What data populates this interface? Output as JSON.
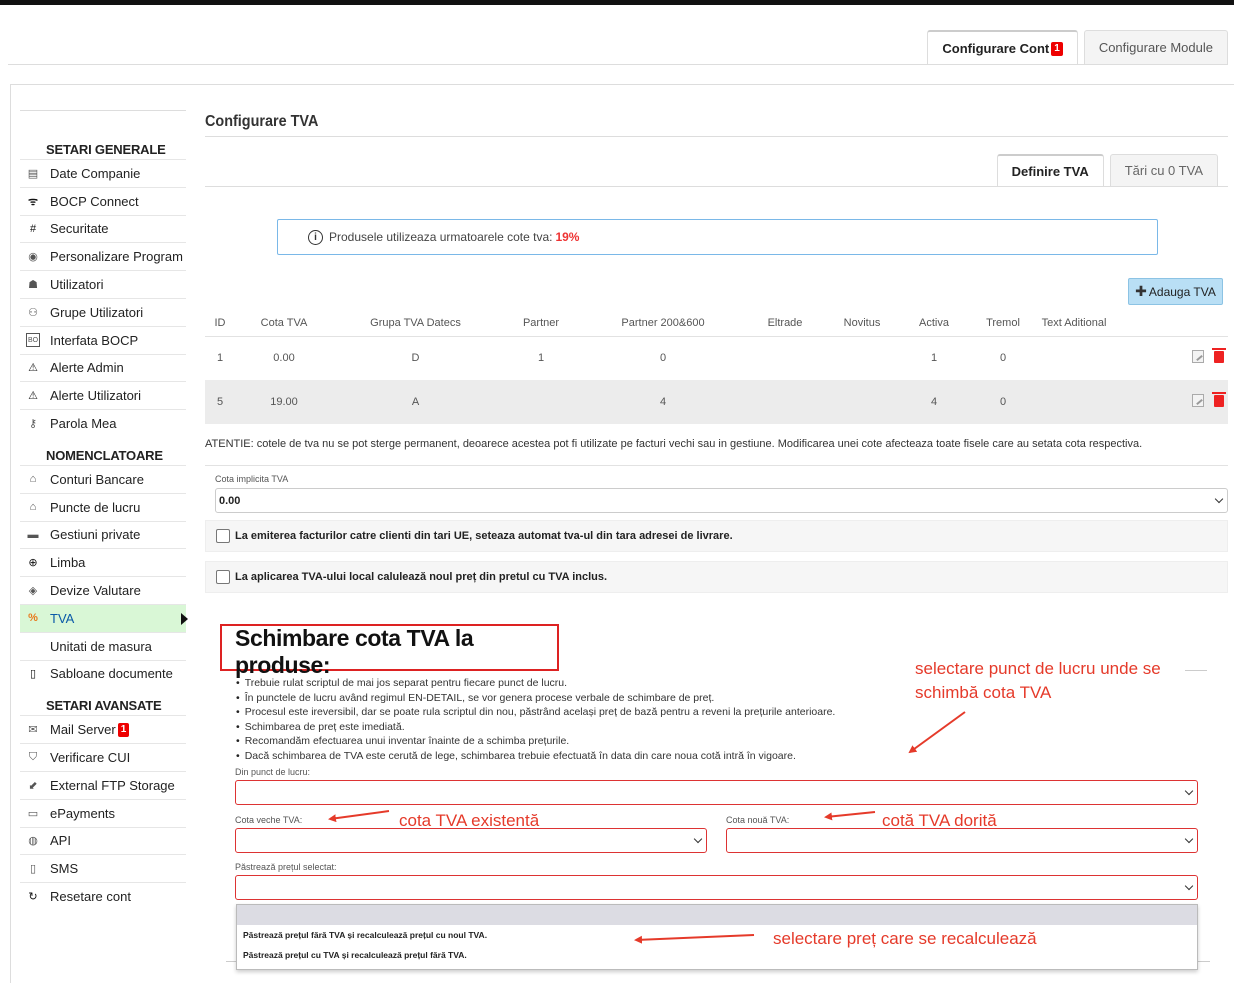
{
  "top_tabs": [
    {
      "label": "Configurare Cont",
      "badge": "1",
      "active": true
    },
    {
      "label": "Configurare Module",
      "active": false
    }
  ],
  "sidebar": {
    "sections": [
      {
        "title": "SETARI GENERALE",
        "items": [
          {
            "label": "Date Companie",
            "icon": "id-card-icon"
          },
          {
            "label": "BOCP Connect",
            "icon": "rss-icon"
          },
          {
            "label": "Securitate",
            "icon": "grid-lock-icon"
          },
          {
            "label": "Personalizare Program",
            "icon": "palette-icon"
          },
          {
            "label": "Utilizatori",
            "icon": "user-icon"
          },
          {
            "label": "Grupe Utilizatori",
            "icon": "users-icon"
          },
          {
            "label": "Interfata BOCP",
            "icon": "bocp-icon"
          },
          {
            "label": "Alerte Admin",
            "icon": "warning-icon"
          },
          {
            "label": "Alerte Utilizatori",
            "icon": "warning-icon"
          },
          {
            "label": "Parola Mea",
            "icon": "key-icon"
          }
        ]
      },
      {
        "title": "NOMENCLATOARE",
        "items": [
          {
            "label": "Conturi Bancare",
            "icon": "bank-icon"
          },
          {
            "label": "Puncte de lucru",
            "icon": "home-icon"
          },
          {
            "label": "Gestiuni private",
            "icon": "hat-icon"
          },
          {
            "label": "Limba",
            "icon": "globe-icon"
          },
          {
            "label": "Devize Valutare",
            "icon": "money-icon"
          },
          {
            "label": "TVA",
            "icon": "percent-icon",
            "active": true
          },
          {
            "label": "Unitati de masura",
            "icon": ""
          },
          {
            "label": "Sabloane documente",
            "icon": "document-icon"
          }
        ]
      },
      {
        "title": "SETARI AVANSATE",
        "items": [
          {
            "label": "Mail Server",
            "icon": "mail-icon",
            "badge": "1"
          },
          {
            "label": "Verificare CUI",
            "icon": "shield-icon"
          },
          {
            "label": "External FTP Storage",
            "icon": "ftp-icon"
          },
          {
            "label": "ePayments",
            "icon": "card-icon"
          },
          {
            "label": "API",
            "icon": "api-icon"
          },
          {
            "label": "SMS",
            "icon": "sms-icon"
          },
          {
            "label": "Resetare cont",
            "icon": "refresh-icon"
          }
        ]
      }
    ]
  },
  "main": {
    "title": "Configurare TVA",
    "sub_tabs": [
      {
        "label": "Definire TVA",
        "active": true
      },
      {
        "label": "Tări cu 0 TVA",
        "active": false
      }
    ],
    "info": {
      "text": "Produsele utilizeaza urmatoarele cote tva:",
      "value": "19%"
    },
    "add_button": "Adauga TVA",
    "table": {
      "headers": [
        "ID",
        "Cota TVA",
        "Grupa TVA Datecs",
        "Partner",
        "Partner 200&600",
        "Eltrade",
        "Novitus",
        "Activa",
        "Tremol",
        "Text Aditional"
      ],
      "rows": [
        [
          "1",
          "0.00",
          "D",
          "1",
          "0",
          "",
          "",
          "1",
          "0",
          ""
        ],
        [
          "5",
          "19.00",
          "A",
          "",
          "4",
          "",
          "",
          "4",
          "0",
          ""
        ]
      ]
    },
    "warning": "ATENTIE: cotele de tva nu se pot sterge permanent, deoarece acestea pot fi utilizate pe facturi vechi sau in gestiune. Modificarea unei cote afecteaza toate fisele care au setata cota respectiva.",
    "default_vat": {
      "label": "Cota implicita TVA",
      "value": "0.00"
    },
    "checkboxes": [
      "La emiterea facturilor catre clienti din tari UE, seteaza automat tva-ul din tara adresei de livrare.",
      "La aplicarea TVA-ului local calulează noul preț din pretul cu TVA inclus."
    ],
    "change_section": {
      "title": "Schimbare cota TVA la produse:",
      "bullets": [
        "Trebuie rulat scriptul de mai jos separat pentru fiecare punct de lucru.",
        "În punctele de lucru având regimul EN-DETAIL, se vor genera procese verbale de schimbare de preț.",
        "Procesul este ireversibil, dar se poate rula scriptul din nou, păstrând același preț de bază pentru a reveni la prețurile anterioare.",
        "Schimbarea de preț este imediată.",
        "Recomandăm efectuarea unui inventar înainte de a schimba prețurile.",
        "Dacă schimbarea de TVA este cerută de lege, schimbarea trebuie efectuată în data din care noua cotă intră în vigoare."
      ],
      "workpoint_label": "Din punct de lucru:",
      "old_vat_label": "Cota veche TVA:",
      "new_vat_label": "Cota nouă TVA:",
      "keep_price_label": "Păstrează prețul selectat:",
      "keep_price_options": [
        "Păstrează prețul fără TVA și recalculează prețul cu noul TVA.",
        "Păstrează prețul cu TVA și recalculează prețul fără TVA."
      ]
    },
    "annotations": {
      "workpoint_1": "selectare punct de lucru unde se",
      "workpoint_2": "schimbă cota TVA",
      "old_vat": "cota TVA existentă",
      "new_vat": "cotă TVA dorită",
      "price": "selectare preț care se recalculează"
    },
    "colors": {
      "accent_red": "#e53a2a",
      "active_green": "#d9f7d6",
      "info_border": "#7ab8e8"
    }
  }
}
